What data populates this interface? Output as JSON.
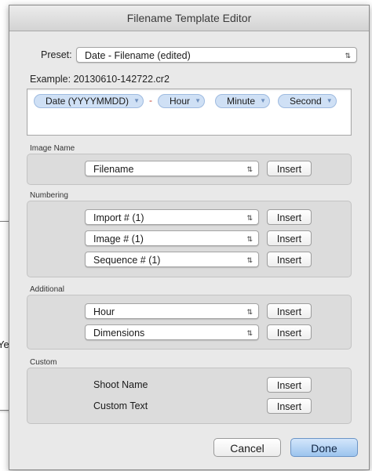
{
  "background_panel": {
    "partial_text": "Year"
  },
  "dialog": {
    "title": "Filename Template Editor"
  },
  "preset": {
    "label": "Preset:",
    "value": "Date - Filename (edited)"
  },
  "example": {
    "text": "Example: 20130610-142722.cr2"
  },
  "tokens": [
    {
      "label": "Date (YYYYMMDD)"
    },
    {
      "label": "Hour"
    },
    {
      "label": "Minute"
    },
    {
      "label": "Second"
    }
  ],
  "token_separator": "-",
  "sections": {
    "image_name": {
      "title": "Image Name",
      "rows": [
        {
          "popup": "Filename",
          "insert": "Insert"
        }
      ]
    },
    "numbering": {
      "title": "Numbering",
      "rows": [
        {
          "popup": "Import # (1)",
          "insert": "Insert"
        },
        {
          "popup": "Image # (1)",
          "insert": "Insert"
        },
        {
          "popup": "Sequence # (1)",
          "insert": "Insert"
        }
      ]
    },
    "additional": {
      "title": "Additional",
      "rows": [
        {
          "popup": "Hour",
          "insert": "Insert"
        },
        {
          "popup": "Dimensions",
          "insert": "Insert"
        }
      ]
    },
    "custom": {
      "title": "Custom",
      "rows": [
        {
          "label": "Shoot Name",
          "insert": "Insert"
        },
        {
          "label": "Custom Text",
          "insert": "Insert"
        }
      ]
    }
  },
  "buttons": {
    "cancel": "Cancel",
    "done": "Done"
  },
  "colors": {
    "token_fill": "#cfe0f5",
    "default_button": "#9cc4ee"
  }
}
